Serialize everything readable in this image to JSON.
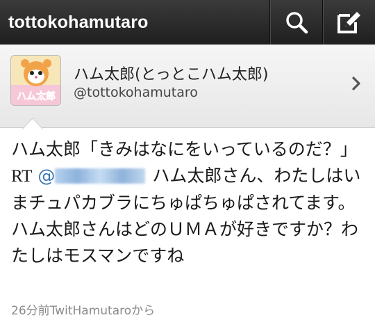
{
  "topbar": {
    "title": "tottokohamutaro",
    "search_icon": "search-icon",
    "compose_icon": "compose-icon"
  },
  "profile": {
    "display_name": "ハム太郎(とっとこハム太郎)",
    "handle": "@tottokohamutaro",
    "avatar_text": "ハム太郎",
    "chevron_icon": "chevron-right-icon"
  },
  "tweet": {
    "text_before": "ハム太郎「きみはなにをいっているのだ？」 ",
    "rt_label": "RT",
    "mention_prefix": "@",
    "text_after": "ハム太郎さん、わたしはいまチュパカブラにちゅぱちゅぱされてます。ハム太郎さんはどのＵＭＡが好きですか？わたしはモスマンですね",
    "meta": "26分前TwitHamutaroから"
  },
  "colors": {
    "topbar": "#2a2a2a",
    "mention": "#3a75b3",
    "meta": "#8a8a8a"
  }
}
